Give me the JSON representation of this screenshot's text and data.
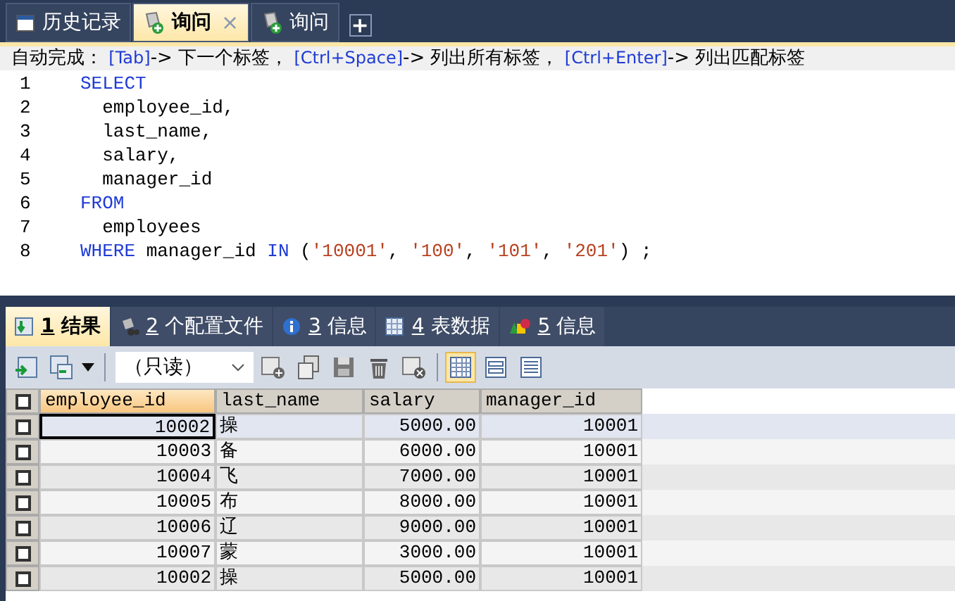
{
  "tabs": [
    {
      "label": "历史记录",
      "kind": "history",
      "selected": false,
      "closable": false
    },
    {
      "label": "询问",
      "kind": "query",
      "selected": true,
      "closable": true
    },
    {
      "label": "询问",
      "kind": "query",
      "selected": false,
      "closable": false
    }
  ],
  "new_tab": "+",
  "close_glyph": "×",
  "hint": [
    {
      "kind": "text",
      "text": "自动完成： "
    },
    {
      "kind": "key",
      "text": "[Tab]"
    },
    {
      "kind": "text",
      "text": "-> 下一个标签， "
    },
    {
      "kind": "key",
      "text": "[Ctrl+Space]"
    },
    {
      "kind": "text",
      "text": "-> 列出所有标签， "
    },
    {
      "kind": "key",
      "text": "[Ctrl+Enter]"
    },
    {
      "kind": "text",
      "text": "-> 列出匹配标签"
    }
  ],
  "editor": {
    "lines": [
      {
        "number": "1",
        "tokens": [
          {
            "kind": "keyword",
            "text": "SELECT"
          }
        ]
      },
      {
        "number": "2",
        "tokens": [
          {
            "kind": "plain",
            "text": "  employee_id,"
          }
        ]
      },
      {
        "number": "3",
        "tokens": [
          {
            "kind": "plain",
            "text": "  last_name,"
          }
        ]
      },
      {
        "number": "4",
        "tokens": [
          {
            "kind": "plain",
            "text": "  salary,"
          }
        ]
      },
      {
        "number": "5",
        "tokens": [
          {
            "kind": "plain",
            "text": "  manager_id"
          }
        ]
      },
      {
        "number": "6",
        "tokens": [
          {
            "kind": "keyword",
            "text": "FROM"
          }
        ]
      },
      {
        "number": "7",
        "tokens": [
          {
            "kind": "plain",
            "text": "  employees"
          }
        ]
      },
      {
        "number": "8",
        "tokens": [
          {
            "kind": "keyword",
            "text": "WHERE"
          },
          {
            "kind": "plain",
            "text": " manager_id "
          },
          {
            "kind": "keyword",
            "text": "IN"
          },
          {
            "kind": "plain",
            "text": " ("
          },
          {
            "kind": "string",
            "text": "'10001'"
          },
          {
            "kind": "plain",
            "text": ", "
          },
          {
            "kind": "string",
            "text": "'100'"
          },
          {
            "kind": "plain",
            "text": ", "
          },
          {
            "kind": "string",
            "text": "'101'"
          },
          {
            "kind": "plain",
            "text": ", "
          },
          {
            "kind": "string",
            "text": "'201'"
          },
          {
            "kind": "plain",
            "text": ") ;"
          }
        ]
      }
    ]
  },
  "result_tabs": [
    {
      "number": "1",
      "label": "结果",
      "kind": "result",
      "selected": true
    },
    {
      "number": "2",
      "label": "个配置文件",
      "kind": "profile",
      "selected": false
    },
    {
      "number": "3",
      "label": "信息",
      "kind": "info",
      "selected": false
    },
    {
      "number": "4",
      "label": "表数据",
      "kind": "table",
      "selected": false
    },
    {
      "number": "5",
      "label": "信息",
      "kind": "info2",
      "selected": false
    }
  ],
  "toolbar": {
    "mode": "（只读）",
    "views": [
      {
        "kind": "grid",
        "selected": true
      },
      {
        "kind": "form",
        "selected": false
      },
      {
        "kind": "text",
        "selected": false
      }
    ]
  },
  "table": {
    "select_all_checked": false,
    "columns": [
      {
        "label": "employee_id",
        "selected": true,
        "kind": "number"
      },
      {
        "label": "last_name",
        "selected": false,
        "kind": "text"
      },
      {
        "label": "salary",
        "selected": false,
        "kind": "number"
      },
      {
        "label": "manager_id",
        "selected": false,
        "kind": "number"
      }
    ],
    "rows": [
      {
        "selected": true,
        "checked": false,
        "cells": [
          "10002",
          "操",
          "5000.00",
          "10001"
        ]
      },
      {
        "selected": false,
        "checked": false,
        "cells": [
          "10003",
          "备",
          "6000.00",
          "10001"
        ]
      },
      {
        "selected": false,
        "checked": false,
        "cells": [
          "10004",
          "飞",
          "7000.00",
          "10001"
        ]
      },
      {
        "selected": false,
        "checked": false,
        "cells": [
          "10005",
          "布",
          "8000.00",
          "10001"
        ]
      },
      {
        "selected": false,
        "checked": false,
        "cells": [
          "10006",
          "辽",
          "9000.00",
          "10001"
        ]
      },
      {
        "selected": false,
        "checked": false,
        "cells": [
          "10007",
          "蒙",
          "3000.00",
          "10001"
        ]
      },
      {
        "selected": false,
        "checked": false,
        "cells": [
          "10002",
          "操",
          "5000.00",
          "10001"
        ]
      }
    ]
  }
}
